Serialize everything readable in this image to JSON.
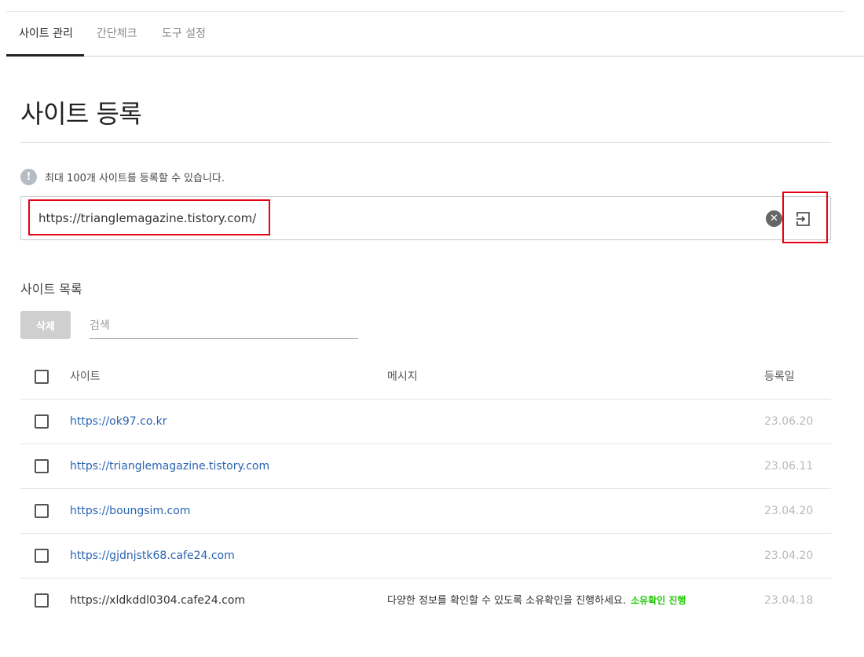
{
  "tabs": [
    {
      "label": "사이트 관리",
      "active": true
    },
    {
      "label": "간단체크",
      "active": false
    },
    {
      "label": "도구 설정",
      "active": false
    }
  ],
  "page_title": "사이트 등록",
  "info": {
    "icon": "exclamation-icon",
    "text": "최대 100개 사이트를 등록할 수 있습니다."
  },
  "url_input": {
    "value": "https://trianglemagazine.tistory.com/"
  },
  "list_title": "사이트 목록",
  "delete_label": "삭제",
  "search": {
    "placeholder": "검색"
  },
  "table": {
    "headers": {
      "site": "사이트",
      "message": "메시지",
      "date": "등록일"
    },
    "rows": [
      {
        "site": "https://ok97.co.kr",
        "message": "",
        "action": "",
        "date": "23.06.20",
        "linked": true
      },
      {
        "site": "https://trianglemagazine.tistory.com",
        "message": "",
        "action": "",
        "date": "23.06.11",
        "linked": true
      },
      {
        "site": "https://boungsim.com",
        "message": "",
        "action": "",
        "date": "23.04.20",
        "linked": true
      },
      {
        "site": "https://gjdnjstk68.cafe24.com",
        "message": "",
        "action": "",
        "date": "23.04.20",
        "linked": true
      },
      {
        "site": "https://xldkddl0304.cafe24.com",
        "message": "다양한 정보를 확인할 수 있도록 소유확인을 진행하세요.",
        "action": "소유확인 진행",
        "date": "23.04.18",
        "linked": false
      }
    ]
  },
  "colors": {
    "accent": "#1ec800",
    "link": "#2a64b2",
    "highlight": "#e60012"
  }
}
